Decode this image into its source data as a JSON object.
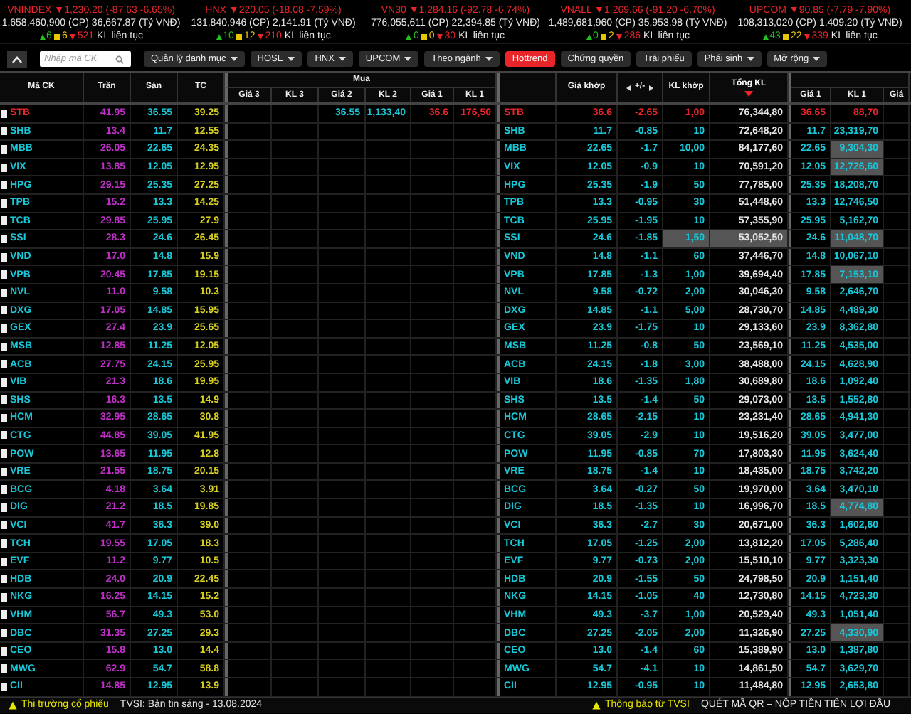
{
  "indices": [
    {
      "title": "VNINDEX ▼1,230.20 (-87.63 -6.65%)",
      "volume": "1,658,460,900 (CP)",
      "turnover": "36,667.87 (Tỷ VNĐ)",
      "up": "6",
      "flat": "6",
      "down": "521",
      "status": "KL liên tục"
    },
    {
      "title": "HNX ▼220.05 (-18.08 -7.59%)",
      "volume": "131,840,946 (CP)",
      "turnover": "2,141.91 (Tỷ VNĐ)",
      "up": "10",
      "flat": "12",
      "down": "210",
      "status": "KL liên tục"
    },
    {
      "title": "VN30 ▼1,284.16 (-92.78 -6.74%)",
      "volume": "776,055,611 (CP)",
      "turnover": "22,394.85 (Tỷ VNĐ)",
      "up": "0",
      "flat": "0",
      "down": "30",
      "status": "KL liên tục"
    },
    {
      "title": "VNALL ▼1,269.66 (-91.20 -6.70%)",
      "volume": "1,489,681,960 (CP)",
      "turnover": "35,953.98 (Tỷ VNĐ)",
      "up": "0",
      "flat": "2",
      "down": "286",
      "status": "KL liên tục"
    },
    {
      "title": "UPCOM ▼90.85 (-7.79 -7.90%)",
      "volume": "108,313,020 (CP)",
      "turnover": "1,409.20 (Tỷ VNĐ)",
      "up": "43",
      "flat": "22",
      "down": "339",
      "status": "KL liên tục"
    }
  ],
  "toolbar": {
    "search": {
      "placeholder": "Nhập mã CK"
    },
    "menus": [
      {
        "label": "Quản lý danh mục",
        "dropdown": true,
        "selected": false
      },
      {
        "label": "HOSE",
        "dropdown": true,
        "selected": false
      },
      {
        "label": "HNX",
        "dropdown": true,
        "selected": false
      },
      {
        "label": "UPCOM",
        "dropdown": true,
        "selected": false
      },
      {
        "label": "Theo ngành",
        "dropdown": true,
        "selected": false
      },
      {
        "label": "Hottrend",
        "dropdown": false,
        "selected": true
      },
      {
        "label": "Chứng quyền",
        "dropdown": false,
        "selected": false
      },
      {
        "label": "Trái phiếu",
        "dropdown": false,
        "selected": false
      },
      {
        "label": "Phái sinh",
        "dropdown": true,
        "selected": false
      },
      {
        "label": "Mở rộng",
        "dropdown": true,
        "selected": false
      }
    ]
  },
  "table": {
    "left_columns": [
      "Mã CK",
      "Trần",
      "Sàn",
      "TC"
    ],
    "bid_group": "Mua",
    "bid_columns": [
      "Giá 3",
      "KL 3",
      "Giá 2",
      "KL 2",
      "Giá 1",
      "KL 1"
    ],
    "match_columns": [
      {
        "label": "Giá khớp",
        "kind": "plain",
        "sorted": false
      },
      {
        "label": "+/-",
        "kind": "toggle",
        "sorted": false
      },
      {
        "label": "KL khớp",
        "kind": "plain",
        "sorted": false
      },
      {
        "label": "Tổng KL",
        "kind": "plain",
        "sorted": true
      }
    ],
    "ask_columns": [
      "Giá 1",
      "KL 1",
      "Giá"
    ],
    "rows": [
      {
        "ticker": "STB",
        "color": "#e8262a",
        "ceiling": "41.95",
        "floor": "36.55",
        "ref": "39.25",
        "bid_2": {
          "price": "36.55",
          "volume": "1,133,40",
          "color": "#18c8d8"
        },
        "bid_1": {
          "price": "36.6",
          "volume": "176,50",
          "color": "#e8262a"
        },
        "match_ticker": "STB",
        "match_price": "36.6",
        "change": "-2.65",
        "match_volume": "1,00",
        "total_volume": "76,344,80",
        "match_highlighted": false,
        "ask_price": "36.65",
        "ask_volume": "88,70",
        "ask_highlighted": false
      },
      {
        "ticker": "SHB",
        "color": "#18c8d8",
        "ceiling": "13.4",
        "floor": "11.7",
        "ref": "12.55",
        "match_ticker": "SHB",
        "match_price": "11.7",
        "change": "-0.85",
        "match_volume": "10",
        "total_volume": "72,648,20",
        "match_highlighted": false,
        "ask_price": "11.7",
        "ask_volume": "23,319,70",
        "ask_highlighted": false
      },
      {
        "ticker": "MBB",
        "color": "#18c8d8",
        "ceiling": "26.05",
        "floor": "22.65",
        "ref": "24.35",
        "match_ticker": "MBB",
        "match_price": "22.65",
        "change": "-1.7",
        "match_volume": "10,00",
        "total_volume": "84,177,60",
        "match_highlighted": false,
        "ask_price": "22.65",
        "ask_volume": "9,304,30",
        "ask_highlighted": true
      },
      {
        "ticker": "VIX",
        "color": "#18c8d8",
        "ceiling": "13.85",
        "floor": "12.05",
        "ref": "12.95",
        "match_ticker": "VIX",
        "match_price": "12.05",
        "change": "-0.9",
        "match_volume": "10",
        "total_volume": "70,591,20",
        "match_highlighted": false,
        "ask_price": "12.05",
        "ask_volume": "12,726,60",
        "ask_highlighted": true
      },
      {
        "ticker": "HPG",
        "color": "#18c8d8",
        "ceiling": "29.15",
        "floor": "25.35",
        "ref": "27.25",
        "match_ticker": "HPG",
        "match_price": "25.35",
        "change": "-1.9",
        "match_volume": "50",
        "total_volume": "77,785,00",
        "match_highlighted": false,
        "ask_price": "25.35",
        "ask_volume": "18,208,70",
        "ask_highlighted": false
      },
      {
        "ticker": "TPB",
        "color": "#18c8d8",
        "ceiling": "15.2",
        "floor": "13.3",
        "ref": "14.25",
        "match_ticker": "TPB",
        "match_price": "13.3",
        "change": "-0.95",
        "match_volume": "30",
        "total_volume": "51,448,60",
        "match_highlighted": false,
        "ask_price": "13.3",
        "ask_volume": "12,746,50",
        "ask_highlighted": false
      },
      {
        "ticker": "TCB",
        "color": "#18c8d8",
        "ceiling": "29.85",
        "floor": "25.95",
        "ref": "27.9",
        "match_ticker": "TCB",
        "match_price": "25.95",
        "change": "-1.95",
        "match_volume": "10",
        "total_volume": "57,355,90",
        "match_highlighted": false,
        "ask_price": "25.95",
        "ask_volume": "5,162,70",
        "ask_highlighted": false
      },
      {
        "ticker": "SSI",
        "color": "#18c8d8",
        "ceiling": "28.3",
        "floor": "24.6",
        "ref": "26.45",
        "match_ticker": "SSI",
        "match_price": "24.6",
        "change": "-1.85",
        "match_volume": "1,50",
        "total_volume": "53,052,50",
        "match_highlighted": true,
        "ask_price": "24.6",
        "ask_volume": "11,048,70",
        "ask_highlighted": true
      },
      {
        "ticker": "VND",
        "color": "#18c8d8",
        "ceiling": "17.0",
        "floor": "14.8",
        "ref": "15.9",
        "match_ticker": "VND",
        "match_price": "14.8",
        "change": "-1.1",
        "match_volume": "60",
        "total_volume": "37,446,70",
        "match_highlighted": false,
        "ask_price": "14.8",
        "ask_volume": "10,067,10",
        "ask_highlighted": false
      },
      {
        "ticker": "VPB",
        "color": "#18c8d8",
        "ceiling": "20.45",
        "floor": "17.85",
        "ref": "19.15",
        "match_ticker": "VPB",
        "match_price": "17.85",
        "change": "-1.3",
        "match_volume": "1,00",
        "total_volume": "39,694,40",
        "match_highlighted": false,
        "ask_price": "17.85",
        "ask_volume": "7,153,10",
        "ask_highlighted": true
      },
      {
        "ticker": "NVL",
        "color": "#18c8d8",
        "ceiling": "11.0",
        "floor": "9.58",
        "ref": "10.3",
        "match_ticker": "NVL",
        "match_price": "9.58",
        "change": "-0.72",
        "match_volume": "2,00",
        "total_volume": "30,046,30",
        "match_highlighted": false,
        "ask_price": "9.58",
        "ask_volume": "2,646,70",
        "ask_highlighted": false
      },
      {
        "ticker": "DXG",
        "color": "#18c8d8",
        "ceiling": "17.05",
        "floor": "14.85",
        "ref": "15.95",
        "match_ticker": "DXG",
        "match_price": "14.85",
        "change": "-1.1",
        "match_volume": "5,00",
        "total_volume": "28,730,70",
        "match_highlighted": false,
        "ask_price": "14.85",
        "ask_volume": "4,489,30",
        "ask_highlighted": false
      },
      {
        "ticker": "GEX",
        "color": "#18c8d8",
        "ceiling": "27.4",
        "floor": "23.9",
        "ref": "25.65",
        "match_ticker": "GEX",
        "match_price": "23.9",
        "change": "-1.75",
        "match_volume": "10",
        "total_volume": "29,133,60",
        "match_highlighted": false,
        "ask_price": "23.9",
        "ask_volume": "8,362,80",
        "ask_highlighted": false
      },
      {
        "ticker": "MSB",
        "color": "#18c8d8",
        "ceiling": "12.85",
        "floor": "11.25",
        "ref": "12.05",
        "match_ticker": "MSB",
        "match_price": "11.25",
        "change": "-0.8",
        "match_volume": "50",
        "total_volume": "23,569,10",
        "match_highlighted": false,
        "ask_price": "11.25",
        "ask_volume": "4,535,00",
        "ask_highlighted": false
      },
      {
        "ticker": "ACB",
        "color": "#18c8d8",
        "ceiling": "27.75",
        "floor": "24.15",
        "ref": "25.95",
        "match_ticker": "ACB",
        "match_price": "24.15",
        "change": "-1.8",
        "match_volume": "3,00",
        "total_volume": "38,488,00",
        "match_highlighted": false,
        "ask_price": "24.15",
        "ask_volume": "4,628,90",
        "ask_highlighted": false
      },
      {
        "ticker": "VIB",
        "color": "#18c8d8",
        "ceiling": "21.3",
        "floor": "18.6",
        "ref": "19.95",
        "match_ticker": "VIB",
        "match_price": "18.6",
        "change": "-1.35",
        "match_volume": "1,80",
        "total_volume": "30,689,80",
        "match_highlighted": false,
        "ask_price": "18.6",
        "ask_volume": "1,092,40",
        "ask_highlighted": false
      },
      {
        "ticker": "SHS",
        "color": "#18c8d8",
        "ceiling": "16.3",
        "floor": "13.5",
        "ref": "14.9",
        "match_ticker": "SHS",
        "match_price": "13.5",
        "change": "-1.4",
        "match_volume": "50",
        "total_volume": "29,073,00",
        "match_highlighted": false,
        "ask_price": "13.5",
        "ask_volume": "1,552,80",
        "ask_highlighted": false
      },
      {
        "ticker": "HCM",
        "color": "#18c8d8",
        "ceiling": "32.95",
        "floor": "28.65",
        "ref": "30.8",
        "match_ticker": "HCM",
        "match_price": "28.65",
        "change": "-2.15",
        "match_volume": "10",
        "total_volume": "23,231,40",
        "match_highlighted": false,
        "ask_price": "28.65",
        "ask_volume": "4,941,30",
        "ask_highlighted": false
      },
      {
        "ticker": "CTG",
        "color": "#18c8d8",
        "ceiling": "44.85",
        "floor": "39.05",
        "ref": "41.95",
        "match_ticker": "CTG",
        "match_price": "39.05",
        "change": "-2.9",
        "match_volume": "10",
        "total_volume": "19,516,20",
        "match_highlighted": false,
        "ask_price": "39.05",
        "ask_volume": "3,477,00",
        "ask_highlighted": false
      },
      {
        "ticker": "POW",
        "color": "#18c8d8",
        "ceiling": "13.65",
        "floor": "11.95",
        "ref": "12.8",
        "match_ticker": "POW",
        "match_price": "11.95",
        "change": "-0.85",
        "match_volume": "70",
        "total_volume": "17,803,30",
        "match_highlighted": false,
        "ask_price": "11.95",
        "ask_volume": "3,624,40",
        "ask_highlighted": false
      },
      {
        "ticker": "VRE",
        "color": "#18c8d8",
        "ceiling": "21.55",
        "floor": "18.75",
        "ref": "20.15",
        "match_ticker": "VRE",
        "match_price": "18.75",
        "change": "-1.4",
        "match_volume": "10",
        "total_volume": "18,435,00",
        "match_highlighted": false,
        "ask_price": "18.75",
        "ask_volume": "3,742,20",
        "ask_highlighted": false
      },
      {
        "ticker": "BCG",
        "color": "#18c8d8",
        "ceiling": "4.18",
        "floor": "3.64",
        "ref": "3.91",
        "match_ticker": "BCG",
        "match_price": "3.64",
        "change": "-0.27",
        "match_volume": "50",
        "total_volume": "19,970,00",
        "match_highlighted": false,
        "ask_price": "3.64",
        "ask_volume": "3,470,10",
        "ask_highlighted": false
      },
      {
        "ticker": "DIG",
        "color": "#18c8d8",
        "ceiling": "21.2",
        "floor": "18.5",
        "ref": "19.85",
        "match_ticker": "DIG",
        "match_price": "18.5",
        "change": "-1.35",
        "match_volume": "10",
        "total_volume": "16,996,70",
        "match_highlighted": false,
        "ask_price": "18.5",
        "ask_volume": "4,774,80",
        "ask_highlighted": true
      },
      {
        "ticker": "VCI",
        "color": "#18c8d8",
        "ceiling": "41.7",
        "floor": "36.3",
        "ref": "39.0",
        "match_ticker": "VCI",
        "match_price": "36.3",
        "change": "-2.7",
        "match_volume": "30",
        "total_volume": "20,671,00",
        "match_highlighted": false,
        "ask_price": "36.3",
        "ask_volume": "1,602,60",
        "ask_highlighted": false
      },
      {
        "ticker": "TCH",
        "color": "#18c8d8",
        "ceiling": "19.55",
        "floor": "17.05",
        "ref": "18.3",
        "match_ticker": "TCH",
        "match_price": "17.05",
        "change": "-1.25",
        "match_volume": "2,00",
        "total_volume": "13,812,20",
        "match_highlighted": false,
        "ask_price": "17.05",
        "ask_volume": "5,286,40",
        "ask_highlighted": false
      },
      {
        "ticker": "EVF",
        "color": "#18c8d8",
        "ceiling": "11.2",
        "floor": "9.77",
        "ref": "10.5",
        "match_ticker": "EVF",
        "match_price": "9.77",
        "change": "-0.73",
        "match_volume": "2,00",
        "total_volume": "15,510,10",
        "match_highlighted": false,
        "ask_price": "9.77",
        "ask_volume": "3,323,30",
        "ask_highlighted": false
      },
      {
        "ticker": "HDB",
        "color": "#18c8d8",
        "ceiling": "24.0",
        "floor": "20.9",
        "ref": "22.45",
        "match_ticker": "HDB",
        "match_price": "20.9",
        "change": "-1.55",
        "match_volume": "50",
        "total_volume": "24,798,50",
        "match_highlighted": false,
        "ask_price": "20.9",
        "ask_volume": "1,151,40",
        "ask_highlighted": false
      },
      {
        "ticker": "NKG",
        "color": "#18c8d8",
        "ceiling": "16.25",
        "floor": "14.15",
        "ref": "15.2",
        "match_ticker": "NKG",
        "match_price": "14.15",
        "change": "-1.05",
        "match_volume": "40",
        "total_volume": "12,730,80",
        "match_highlighted": false,
        "ask_price": "14.15",
        "ask_volume": "4,723,30",
        "ask_highlighted": false
      },
      {
        "ticker": "VHM",
        "color": "#18c8d8",
        "ceiling": "56.7",
        "floor": "49.3",
        "ref": "53.0",
        "match_ticker": "VHM",
        "match_price": "49.3",
        "change": "-3.7",
        "match_volume": "1,00",
        "total_volume": "20,529,40",
        "match_highlighted": false,
        "ask_price": "49.3",
        "ask_volume": "1,051,40",
        "ask_highlighted": false
      },
      {
        "ticker": "DBC",
        "color": "#18c8d8",
        "ceiling": "31.35",
        "floor": "27.25",
        "ref": "29.3",
        "match_ticker": "DBC",
        "match_price": "27.25",
        "change": "-2.05",
        "match_volume": "2,00",
        "total_volume": "11,326,90",
        "match_highlighted": false,
        "ask_price": "27.25",
        "ask_volume": "4,330,90",
        "ask_highlighted": true
      },
      {
        "ticker": "CEO",
        "color": "#18c8d8",
        "ceiling": "15.8",
        "floor": "13.0",
        "ref": "14.4",
        "match_ticker": "CEO",
        "match_price": "13.0",
        "change": "-1.4",
        "match_volume": "60",
        "total_volume": "15,389,90",
        "match_highlighted": false,
        "ask_price": "13.0",
        "ask_volume": "1,387,80",
        "ask_highlighted": false
      },
      {
        "ticker": "MWG",
        "color": "#18c8d8",
        "ceiling": "62.9",
        "floor": "54.7",
        "ref": "58.8",
        "match_ticker": "MWG",
        "match_price": "54.7",
        "change": "-4.1",
        "match_volume": "10",
        "total_volume": "14,861,50",
        "match_highlighted": false,
        "ask_price": "54.7",
        "ask_volume": "3,629,70",
        "ask_highlighted": false
      },
      {
        "ticker": "CII",
        "color": "#18c8d8",
        "ceiling": "14.85",
        "floor": "12.95",
        "ref": "13.9",
        "match_ticker": "CII",
        "match_price": "12.95",
        "change": "-0.95",
        "match_volume": "10",
        "total_volume": "11,484,80",
        "match_highlighted": false,
        "ask_price": "12.95",
        "ask_volume": "2,653,80",
        "ask_highlighted": false
      }
    ]
  },
  "footer": {
    "left": {
      "title": "Thị trường cổ phiếu",
      "text": "TVSI: Bản tin sáng - 13.08.2024"
    },
    "right": {
      "title": "Thông báo từ TVSI",
      "text": "QUÉT MÃ QR – NỘP TIỀN TIỆN LỢI ĐẦU"
    }
  }
}
